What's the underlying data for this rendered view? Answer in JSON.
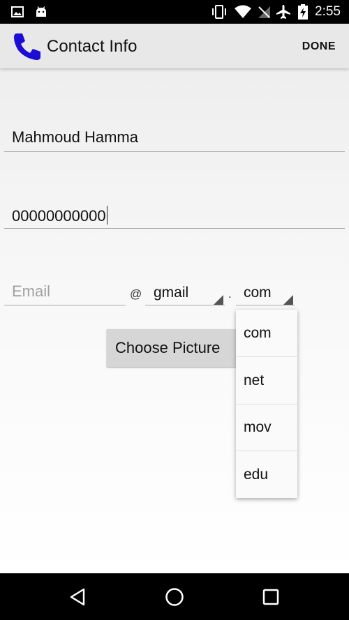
{
  "status_bar": {
    "time": "2:55",
    "icons": [
      "image-icon",
      "android-icon",
      "vibrate-icon",
      "wifi-icon",
      "no-sim-icon",
      "airplane-icon",
      "battery-charging-icon"
    ]
  },
  "app_bar": {
    "title": "Contact Info",
    "done_label": "DONE",
    "icon": "phone-icon",
    "icon_color": "#1a0dd6"
  },
  "form": {
    "name_value": "Mahmoud Hamma",
    "phone_value": "00000000000",
    "email_placeholder": "Email",
    "at_sign": "@",
    "domain_selected": "gmail",
    "dot_sign": ".",
    "tld_selected": "com",
    "choose_picture_label": "Choose Picture"
  },
  "dropdown": {
    "options": [
      "com",
      "net",
      "mov",
      "edu"
    ]
  },
  "nav_bar": {
    "icons": [
      "back-icon",
      "home-icon",
      "recents-icon"
    ]
  }
}
